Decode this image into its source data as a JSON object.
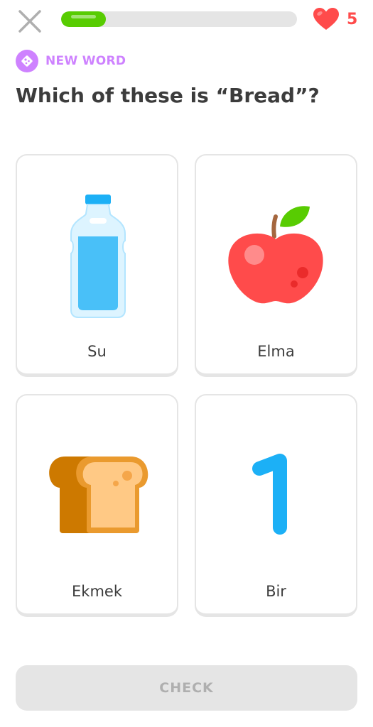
{
  "header": {
    "close_icon": "close-icon",
    "progress": 0.19,
    "progress_color": "#58cc02",
    "hearts": {
      "icon": "heart-icon",
      "count": "5",
      "color": "#ff4b4b"
    }
  },
  "badge": {
    "icon": "new-word-icon",
    "label": "NEW WORD",
    "color": "#ce82ff"
  },
  "question": "Which of these is “Bread”?",
  "options": [
    {
      "label": "Su",
      "icon": "water-bottle-icon"
    },
    {
      "label": "Elma",
      "icon": "apple-icon"
    },
    {
      "label": "Ekmek",
      "icon": "bread-icon"
    },
    {
      "label": "Bir",
      "icon": "number-one-icon"
    }
  ],
  "footer": {
    "check_label": "CHECK",
    "check_enabled": false
  }
}
